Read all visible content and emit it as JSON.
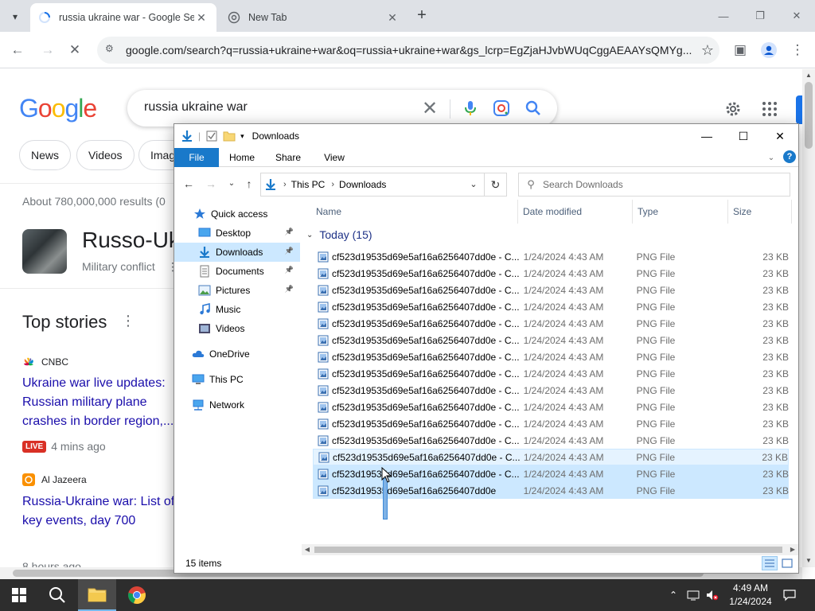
{
  "browser": {
    "tabs": [
      {
        "title": "russia ukraine war - Google Sea",
        "active": true
      },
      {
        "title": "New Tab",
        "active": false
      }
    ],
    "url": "google.com/search?q=russia+ukraine+war&oq=russia+ukraine+war&gs_lcrp=EgZjaHJvbWUqCggAEAAYsQMYg..."
  },
  "google": {
    "query": "russia ukraine war",
    "chips": [
      "News",
      "Videos",
      "Imag"
    ],
    "results_count": "About 780,000,000 results (0",
    "knowledge_panel": {
      "title": "Russo-Uk",
      "subtitle": "Military conflict"
    },
    "top_stories_label": "Top stories",
    "stories": [
      {
        "source": "CNBC",
        "headline": "Ukraine war live updates: Russian military plane crashes in border region,...",
        "live": "LIVE",
        "time": "4 mins ago"
      },
      {
        "source": "Al Jazeera",
        "headline": "Russia-Ukraine war: List of key events, day 700",
        "time": "8 hours ago"
      }
    ]
  },
  "explorer": {
    "title": "Downloads",
    "ribbon_tabs": [
      "File",
      "Home",
      "Share",
      "View"
    ],
    "help": "?",
    "breadcrumb": [
      "This PC",
      "Downloads"
    ],
    "search_placeholder": "Search Downloads",
    "nav": [
      {
        "label": "Quick access",
        "icon": "star-icon"
      },
      {
        "label": "Desktop",
        "icon": "desktop-icon",
        "pinned": true
      },
      {
        "label": "Downloads",
        "icon": "download-folder-icon",
        "pinned": true,
        "selected": true
      },
      {
        "label": "Documents",
        "icon": "documents-icon",
        "pinned": true
      },
      {
        "label": "Pictures",
        "icon": "pictures-icon",
        "pinned": true
      },
      {
        "label": "Music",
        "icon": "music-icon"
      },
      {
        "label": "Videos",
        "icon": "videos-icon"
      },
      {
        "label": "OneDrive",
        "icon": "cloud-icon"
      },
      {
        "label": "This PC",
        "icon": "computer-icon"
      },
      {
        "label": "Network",
        "icon": "network-icon"
      }
    ],
    "columns": [
      "Name",
      "Date modified",
      "Type",
      "Size"
    ],
    "group_label": "Today (15)",
    "files": [
      {
        "name": "cf523d19535d69e5af16a6256407dd0e - C...",
        "date": "1/24/2024 4:43 AM",
        "type": "PNG File",
        "size": "23 KB"
      },
      {
        "name": "cf523d19535d69e5af16a6256407dd0e - C...",
        "date": "1/24/2024 4:43 AM",
        "type": "PNG File",
        "size": "23 KB"
      },
      {
        "name": "cf523d19535d69e5af16a6256407dd0e - C...",
        "date": "1/24/2024 4:43 AM",
        "type": "PNG File",
        "size": "23 KB"
      },
      {
        "name": "cf523d19535d69e5af16a6256407dd0e - C...",
        "date": "1/24/2024 4:43 AM",
        "type": "PNG File",
        "size": "23 KB"
      },
      {
        "name": "cf523d19535d69e5af16a6256407dd0e - C...",
        "date": "1/24/2024 4:43 AM",
        "type": "PNG File",
        "size": "23 KB"
      },
      {
        "name": "cf523d19535d69e5af16a6256407dd0e - C...",
        "date": "1/24/2024 4:43 AM",
        "type": "PNG File",
        "size": "23 KB"
      },
      {
        "name": "cf523d19535d69e5af16a6256407dd0e - C...",
        "date": "1/24/2024 4:43 AM",
        "type": "PNG File",
        "size": "23 KB"
      },
      {
        "name": "cf523d19535d69e5af16a6256407dd0e - C...",
        "date": "1/24/2024 4:43 AM",
        "type": "PNG File",
        "size": "23 KB"
      },
      {
        "name": "cf523d19535d69e5af16a6256407dd0e - C...",
        "date": "1/24/2024 4:43 AM",
        "type": "PNG File",
        "size": "23 KB"
      },
      {
        "name": "cf523d19535d69e5af16a6256407dd0e - C...",
        "date": "1/24/2024 4:43 AM",
        "type": "PNG File",
        "size": "23 KB"
      },
      {
        "name": "cf523d19535d69e5af16a6256407dd0e - C...",
        "date": "1/24/2024 4:43 AM",
        "type": "PNG File",
        "size": "23 KB"
      },
      {
        "name": "cf523d19535d69e5af16a6256407dd0e - C...",
        "date": "1/24/2024 4:43 AM",
        "type": "PNG File",
        "size": "23 KB"
      },
      {
        "name": "cf523d19535d69e5af16a6256407dd0e - C...",
        "date": "1/24/2024 4:43 AM",
        "type": "PNG File",
        "size": "23 KB",
        "state": "hover"
      },
      {
        "name": "cf523d19535d69e5af16a6256407dd0e - C...",
        "date": "1/24/2024 4:43 AM",
        "type": "PNG File",
        "size": "23 KB",
        "state": "selected"
      },
      {
        "name": "cf523d19535d69e5af16a6256407dd0e",
        "date": "1/24/2024 4:43 AM",
        "type": "PNG File",
        "size": "23 KB",
        "state": "selected"
      }
    ],
    "status": "15 items"
  },
  "taskbar": {
    "time": "4:49 AM",
    "date": "1/24/2024"
  },
  "colors": {
    "accent_blue": "#1979ca",
    "selection": "#cce8ff",
    "google_link": "#1a0dab",
    "taskbar": "#2d2d2d"
  }
}
